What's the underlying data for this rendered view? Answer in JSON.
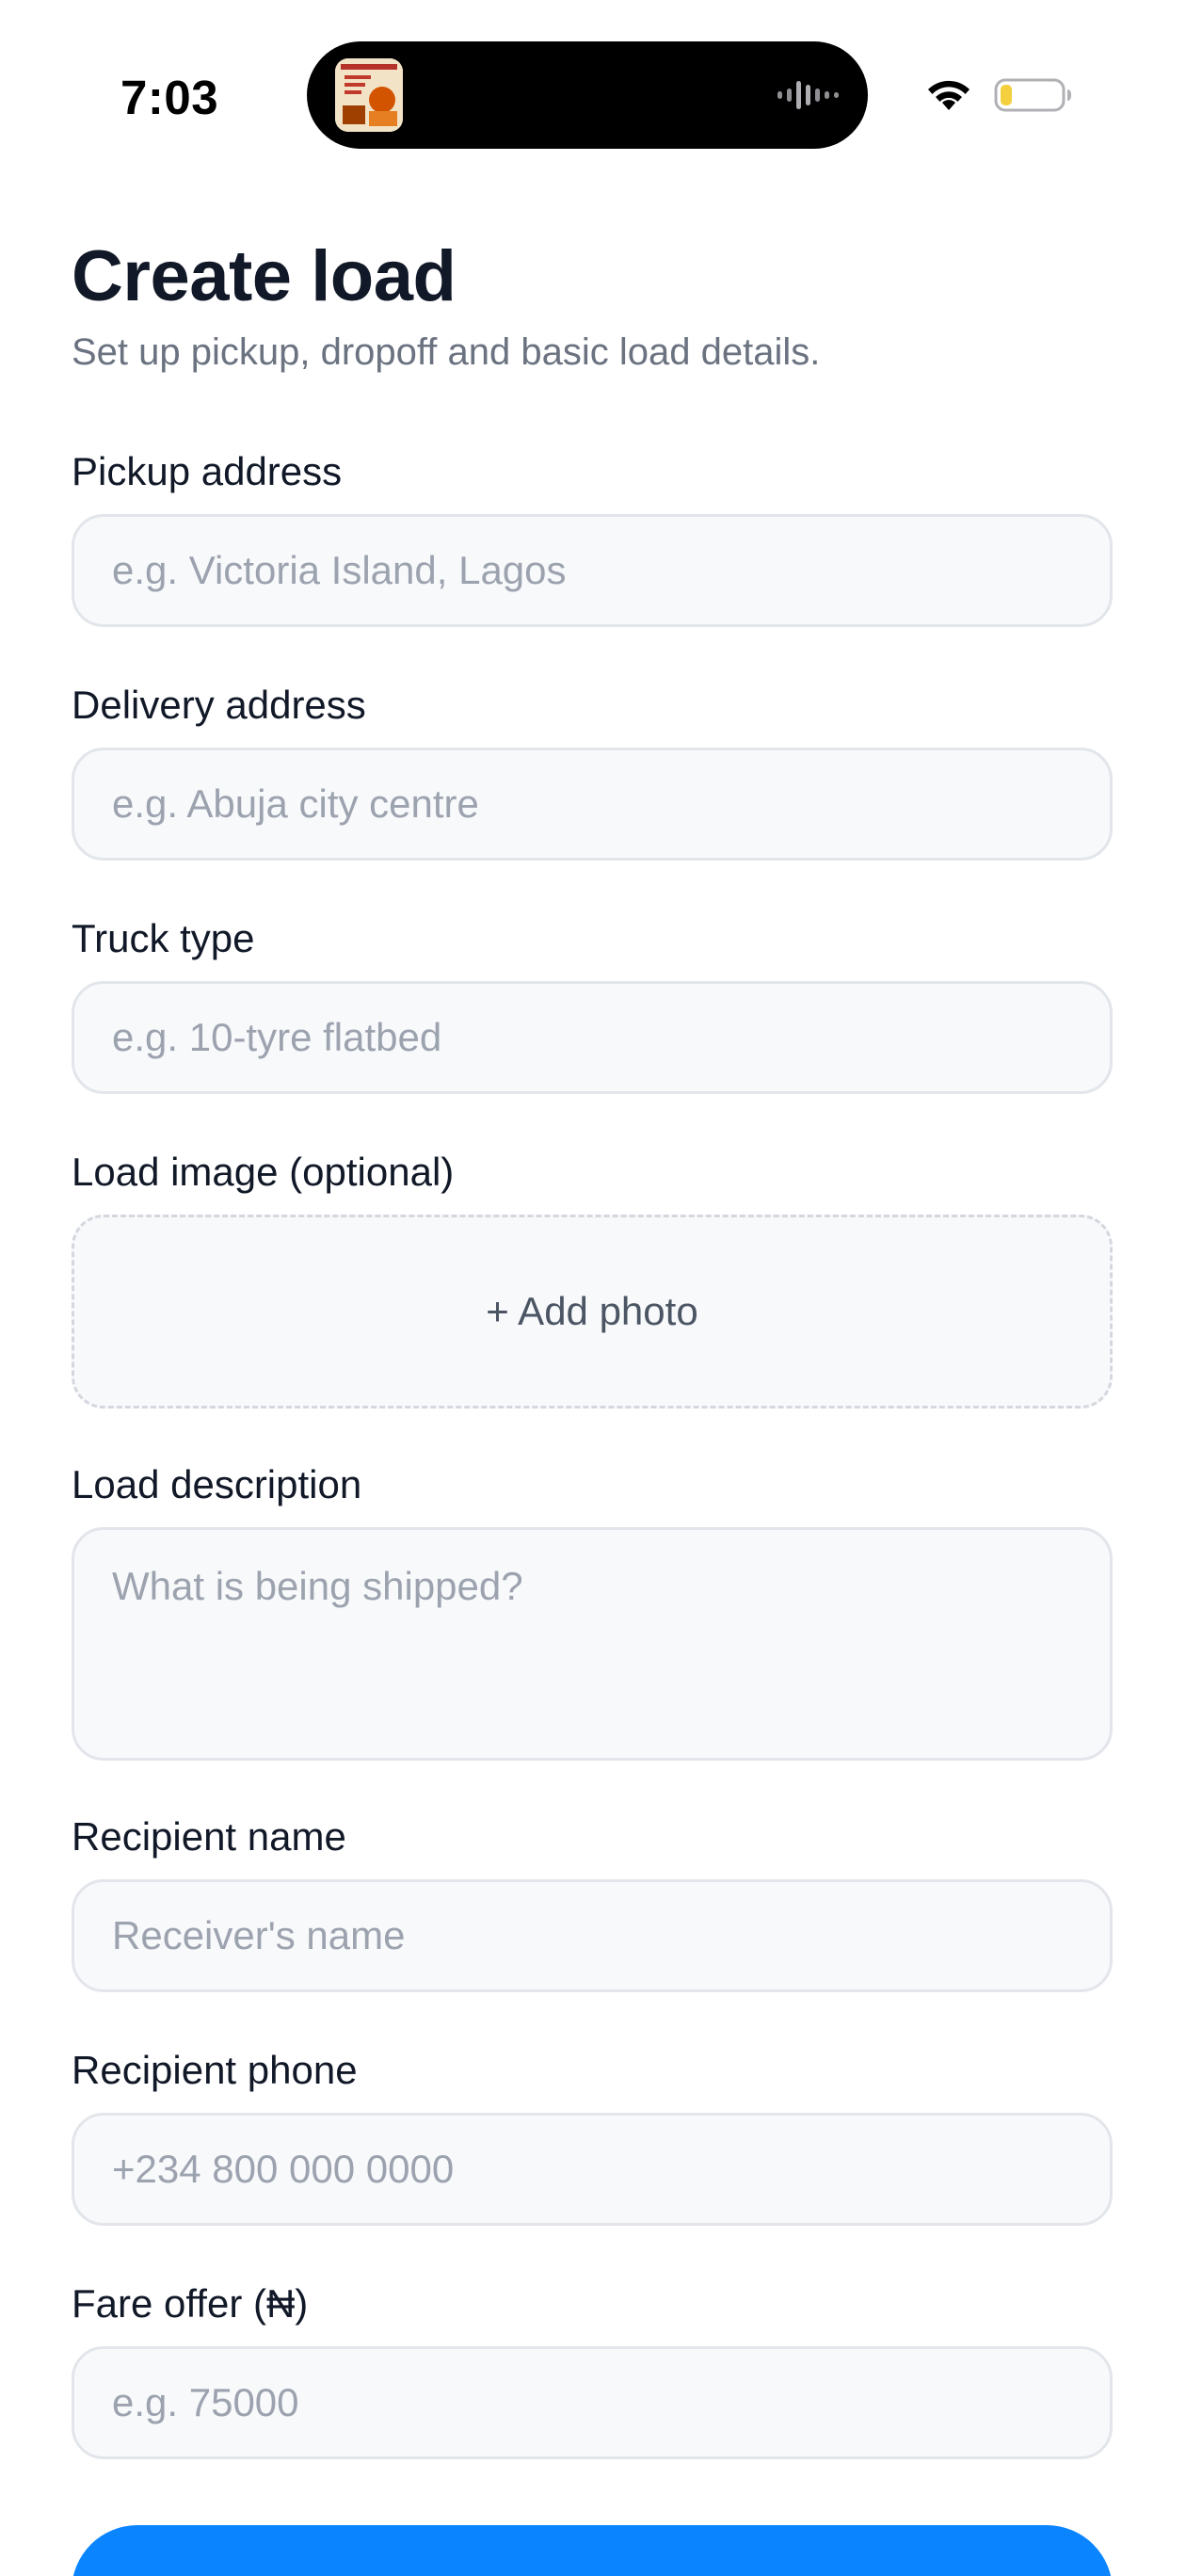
{
  "status_bar": {
    "time": "7:03",
    "icons": [
      "now-playing-thumbnail",
      "audio-wave-icon",
      "wifi-icon",
      "battery-icon"
    ],
    "battery_level": 0.2,
    "battery_color": "#f4d03f"
  },
  "header": {
    "title": "Create load",
    "subtitle": "Set up pickup, dropoff and basic load details."
  },
  "form": {
    "pickup": {
      "label": "Pickup address",
      "placeholder": "e.g. Victoria Island, Lagos",
      "value": ""
    },
    "delivery": {
      "label": "Delivery address",
      "placeholder": "e.g. Abuja city centre",
      "value": ""
    },
    "truck_type": {
      "label": "Truck type",
      "placeholder": "e.g. 10-tyre flatbed",
      "value": ""
    },
    "load_image": {
      "label": "Load image (optional)",
      "button_label": "+ Add photo"
    },
    "description": {
      "label": "Load description",
      "placeholder": "What is being shipped?",
      "value": ""
    },
    "recipient_name": {
      "label": "Recipient name",
      "placeholder": "Receiver's name",
      "value": ""
    },
    "recipient_phone": {
      "label": "Recipient phone",
      "placeholder": "+234 800 000 0000",
      "value": ""
    },
    "fare_offer": {
      "label": "Fare offer (₦)",
      "placeholder": "e.g. 75000",
      "value": ""
    }
  },
  "theme": {
    "accent": "#0a84ff",
    "input_background": "#f8f9fb",
    "input_border": "#e2e5ea",
    "placeholder": "#9ca3af",
    "title_color": "#111827",
    "subtitle_color": "#6b7280"
  }
}
